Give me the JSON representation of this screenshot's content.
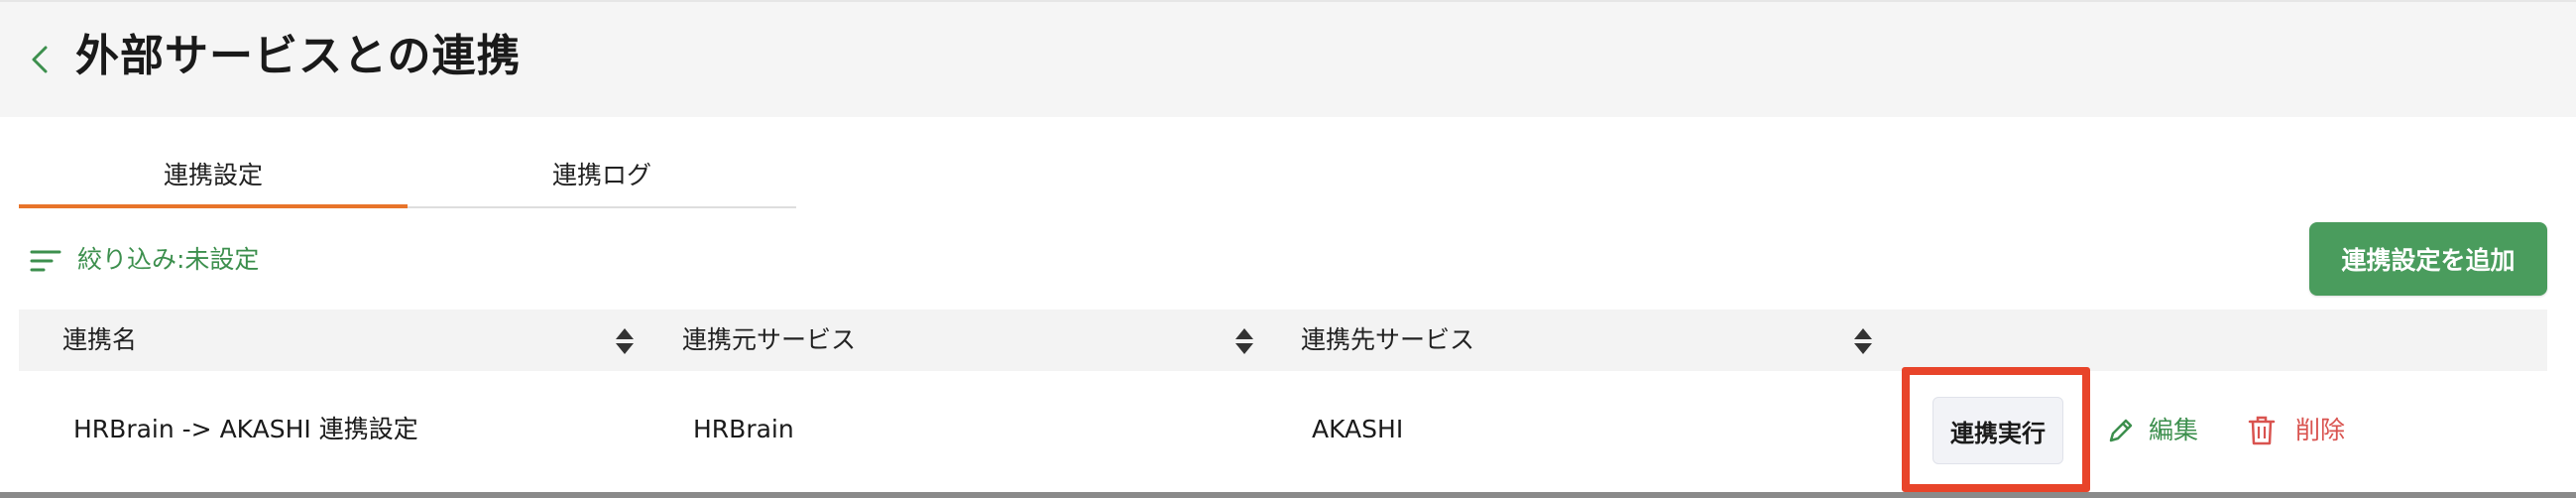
{
  "header": {
    "title": "外部サービスとの連携",
    "back_icon": "chevron-left-icon"
  },
  "tabs": [
    {
      "label": "連携設定",
      "active": true
    },
    {
      "label": "連携ログ",
      "active": false
    }
  ],
  "filter": {
    "icon": "filter-lines-icon",
    "label": "絞り込み:未設定"
  },
  "toolbar": {
    "add_label": "連携設定を追加"
  },
  "table": {
    "columns": [
      "連携名",
      "連携元サービス",
      "連携先サービス"
    ],
    "rows": [
      {
        "name": "HRBrain -> AKASHI 連携設定",
        "source": "HRBrain",
        "destination": "AKASHI",
        "run_label": "連携実行",
        "edit_label": "編集",
        "delete_label": "削除"
      }
    ]
  },
  "colors": {
    "accent_green": "#4a9c5d",
    "link_green": "#3c8f4d",
    "tab_active": "#e8742a",
    "danger": "#d9534f",
    "highlight": "#e8442a"
  }
}
